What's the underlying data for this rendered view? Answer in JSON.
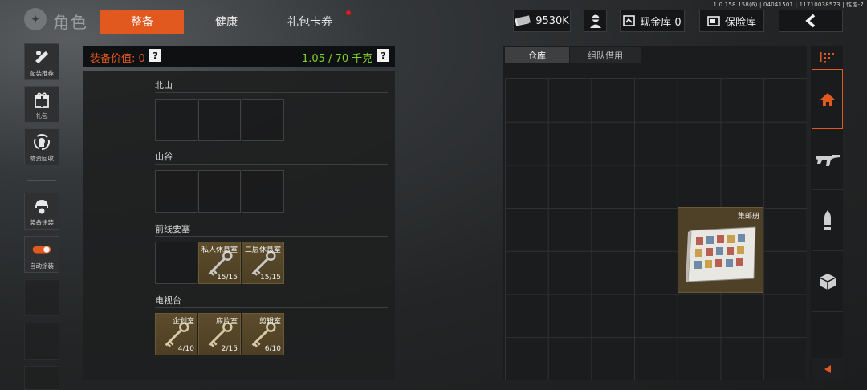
{
  "version": "1.0.158.158(6) | 04041501 | 11710038573 | 性能-7",
  "header": {
    "title": "角色",
    "tabs": [
      {
        "label": "整备",
        "active": true
      },
      {
        "label": "健康",
        "active": false
      },
      {
        "label": "礼包卡券",
        "active": false,
        "has_notification": true
      }
    ],
    "money": "9530K",
    "cash_storage_label": "现金库 0",
    "safe_label": "保险库",
    "accent_color": "#e2591f"
  },
  "sidebar": {
    "buttons": [
      {
        "label": "配装推荐",
        "icon": "rifle-scope-icon"
      },
      {
        "label": "礼包",
        "icon": "gift-icon"
      },
      {
        "label": "物资回收",
        "icon": "recycle-icon"
      },
      {
        "label": "装备涂装",
        "icon": "helmet-icon"
      },
      {
        "label": "自动涂装",
        "icon": "toggle-icon",
        "toggle_on": true
      }
    ]
  },
  "equipment": {
    "value_label": "装备价值: 0",
    "help": "?",
    "weight_label": "1.05 / 70 千克",
    "sections": [
      {
        "title": "北山",
        "slots": []
      },
      {
        "title": "山谷",
        "slots": []
      },
      {
        "title": "前线要塞",
        "slots": [
          {
            "name": "私人休息室",
            "count": "15/15"
          },
          {
            "name": "二层休息室",
            "count": "15/15"
          }
        ]
      },
      {
        "title": "电视台",
        "slots": [
          {
            "name": "企划室",
            "count": "4/10"
          },
          {
            "name": "底片室",
            "count": "2/15"
          },
          {
            "name": "剪辑室",
            "count": "6/10"
          }
        ]
      }
    ]
  },
  "storage": {
    "tabs": [
      {
        "label": "仓库",
        "active": true
      },
      {
        "label": "组队借用",
        "active": false
      }
    ],
    "item": {
      "name": "集邮册",
      "icon": "stamp-album-icon"
    }
  },
  "categories": [
    "home-icon",
    "rifle-icon",
    "ammo-icon",
    "box-icon"
  ]
}
